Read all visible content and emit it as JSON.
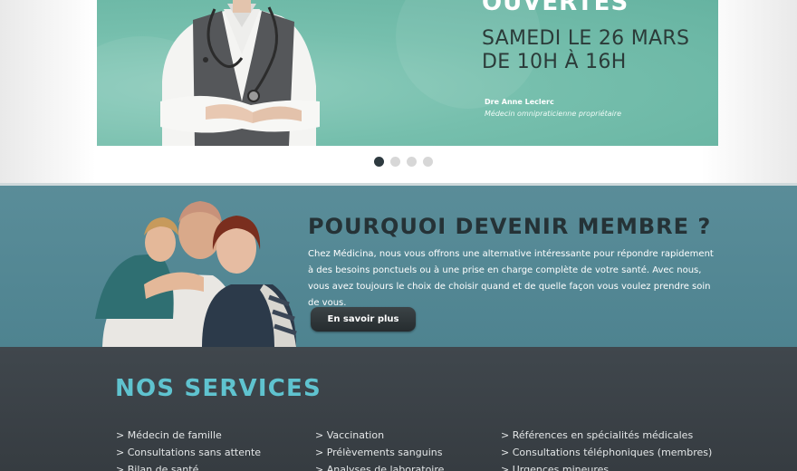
{
  "hero": {
    "title": "OUVERTES",
    "date_text": "SAMEDI LE 26 MARS DE 10H À 16H",
    "doctor_name": "Dre Anne Leclerc",
    "doctor_role": "Médecin omnipraticienne propriétaire"
  },
  "slider": {
    "dot_count": 4,
    "active_index": 0
  },
  "membership": {
    "title": "POURQUOI DEVENIR MEMBRE ?",
    "text": "Chez Médicina, nous vous offrons une alternative intéressante pour répondre rapidement à des besoins ponctuels ou à une prise en charge complète de votre santé. Avec nous, vous avez toujours le choix de choisir quand et de quelle façon vous voulez prendre soin de vous.",
    "button_label": "En savoir plus"
  },
  "services": {
    "title": "NOS SERVICES",
    "columns": [
      [
        "> Médecin de famille",
        "> Consultations sans attente",
        "> Bilan de santé"
      ],
      [
        "> Vaccination",
        "> Prélèvements sanguins",
        "> Analyses de laboratoire"
      ],
      [
        "> Références en spécialités médicales",
        "> Consultations téléphoniques (membres)",
        "> Urgences mineures"
      ]
    ]
  },
  "colors": {
    "hero_teal": "#76bfad",
    "member_band": "#5a8d99",
    "services_bg": "#3c4348",
    "services_title": "#5fc3cf",
    "button_dark": "#2e3437"
  }
}
